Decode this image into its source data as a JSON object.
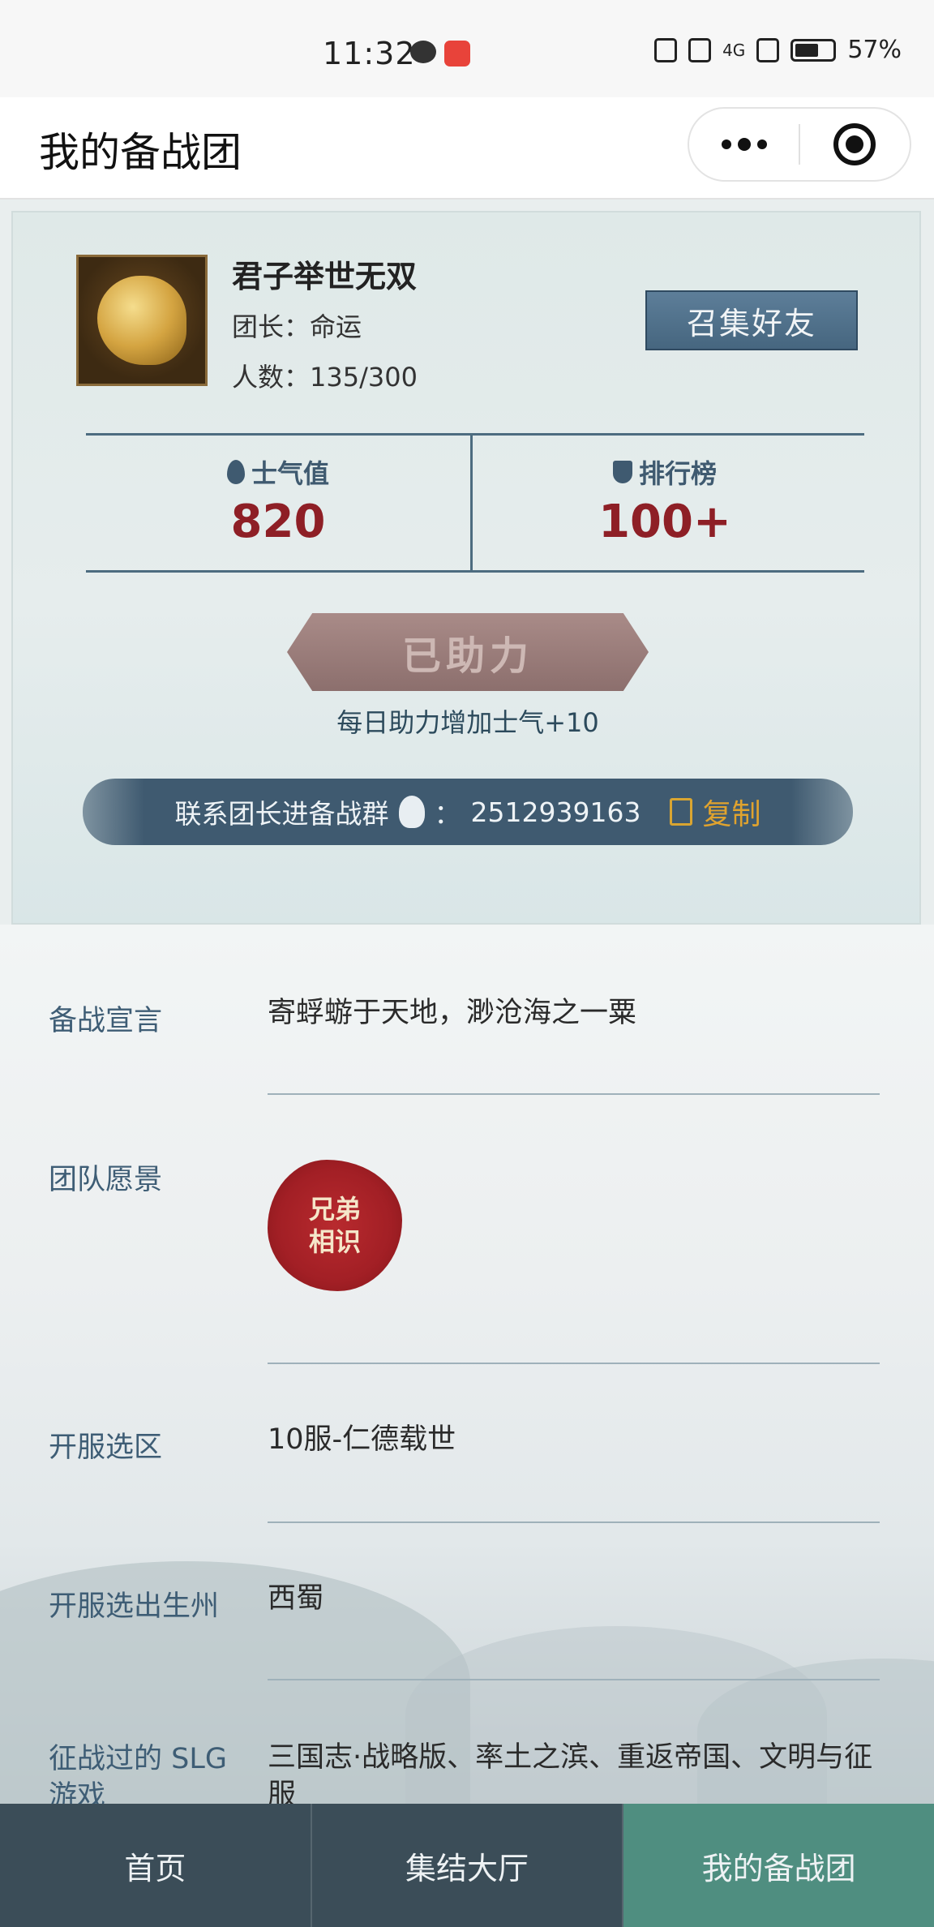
{
  "status_bar": {
    "time": "11:32",
    "battery": "57%",
    "signal_label": "4G"
  },
  "nav": {
    "title": "我的备战团"
  },
  "team": {
    "name": "君子举世无双",
    "leader": "团长：命运",
    "count": "人数：135/300",
    "gather_label": "召集好友"
  },
  "stats": {
    "morale_label": "士气值",
    "morale_value": "820",
    "rank_label": "排行榜",
    "rank_value": "100+"
  },
  "help": {
    "button_label": "已助力",
    "tip": "每日助力增加士气+10"
  },
  "group": {
    "text": "联系团长进备战群",
    "separator": "：",
    "qq_number": "2512939163",
    "copy_label": "复制"
  },
  "fields": {
    "declaration_label": "备战宣言",
    "declaration_value": "寄蜉蝣于天地，渺沧海之一粟",
    "vision_label": "团队愿景",
    "vision_seal_line1": "兄弟",
    "vision_seal_line2": "相识",
    "server_label": "开服选区",
    "server_value": "10服-仁德载世",
    "state_label": "开服选出生州",
    "state_value": "西蜀",
    "slg_label": "征战过的 SLG 游戏",
    "slg_value": "三国志·战略版、率土之滨、重返帝国、文明与征服"
  },
  "tabs": [
    {
      "label": "首页"
    },
    {
      "label": "集结大厅"
    },
    {
      "label": "我的备战团"
    }
  ],
  "colors": {
    "accent_red": "#8e1f26",
    "slate_blue": "#3f5a70",
    "active_tab": "#4f8e80",
    "copy_gold": "#e0a32e"
  }
}
